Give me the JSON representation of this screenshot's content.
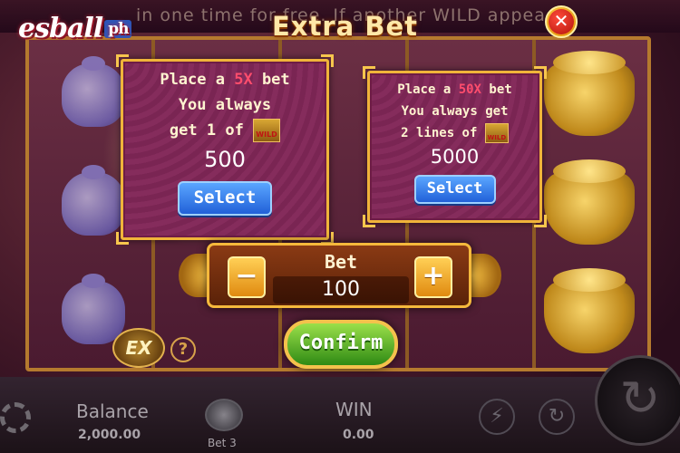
{
  "header": {
    "logo_text": "esball",
    "logo_suffix": "ph",
    "marquee": "in one time for free. If another WILD appea",
    "title": "Extra Bet",
    "close_glyph": "✕"
  },
  "options": [
    {
      "line1_prefix": "Place a ",
      "multiplier": "5X",
      "line1_suffix": " bet",
      "line2": "You always",
      "line3": "get 1 of",
      "wild_label": "WILD",
      "value": "500",
      "button": "Select"
    },
    {
      "line1_prefix": "Place a ",
      "multiplier": "50X",
      "line1_suffix": " bet",
      "line2": "You always get",
      "line3": "2 lines of",
      "wild_label": "WILD",
      "value": "5000",
      "button": "Select"
    }
  ],
  "bet": {
    "label": "Bet",
    "value": "100",
    "minus": "−",
    "plus": "+"
  },
  "confirm": "Confirm",
  "side": {
    "ex_label": "EX",
    "help": "?"
  },
  "footer": {
    "balance_label": "Balance",
    "balance_value": "2,000.00",
    "bet_label": "Bet 3",
    "win_label": "WIN",
    "win_value": "0.00",
    "bolt_glyph": "⚡",
    "auto_glyph": "↻",
    "spin_glyph": "↻"
  },
  "colors": {
    "accent_gold": "#f0b43a",
    "multiplier_red": "#ff4d6d",
    "select_blue": "#2160d8",
    "confirm_green": "#2f8a14",
    "close_red": "#b3140c"
  }
}
